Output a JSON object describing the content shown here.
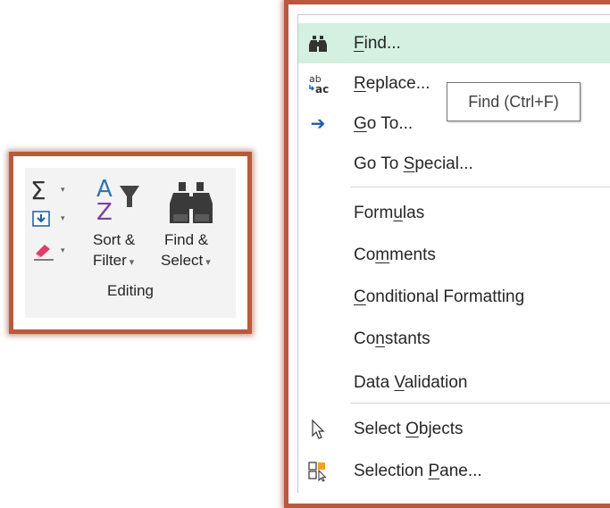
{
  "ribbon": {
    "group_label": "Editing",
    "sort_filter": {
      "line1": "Sort &",
      "line2": "Filter",
      "caret": "▾"
    },
    "find_select": {
      "line1": "Find &",
      "line2": "Select",
      "caret": "▾"
    },
    "sigma_glyph": "Σ",
    "caret": "▾",
    "sort_letters": {
      "a": "A",
      "z": "Z"
    }
  },
  "menu": {
    "items": [
      {
        "id": "find",
        "pre": "",
        "ul": "F",
        "post": "ind...",
        "icon": "binoculars-icon",
        "hover": true
      },
      {
        "id": "replace",
        "pre": "",
        "ul": "R",
        "post": "eplace...",
        "icon": "replace-icon",
        "icon_text_top": "ab",
        "icon_text_bottom": "ac"
      },
      {
        "id": "goto",
        "pre": "",
        "ul": "G",
        "post": "o To...",
        "icon": "arrow-right-icon",
        "icon_glyph": "➔"
      },
      {
        "id": "goto-special",
        "pre": "Go To ",
        "ul": "S",
        "post": "pecial...",
        "icon": ""
      },
      {
        "id": "formulas",
        "pre": "Form",
        "ul": "u",
        "post": "las",
        "icon": ""
      },
      {
        "id": "comments",
        "pre": "Co",
        "ul": "m",
        "post": "ments",
        "icon": ""
      },
      {
        "id": "conditional-formatting",
        "pre": "",
        "ul": "C",
        "post": "onditional Formatting",
        "icon": ""
      },
      {
        "id": "constants",
        "pre": "Co",
        "ul": "n",
        "post": "stants",
        "icon": ""
      },
      {
        "id": "data-validation",
        "pre": "Data ",
        "ul": "V",
        "post": "alidation",
        "icon": ""
      },
      {
        "id": "select-objects",
        "pre": "Select ",
        "ul": "O",
        "post": "bjects",
        "icon": "pointer-icon"
      },
      {
        "id": "selection-pane",
        "pre": "Selection ",
        "ul": "P",
        "post": "ane...",
        "icon": "selection-pane-icon"
      }
    ]
  },
  "tooltip": {
    "text": "Find (Ctrl+F)"
  },
  "colors": {
    "frame": "#b85a3c",
    "hover": "#d3f0e0",
    "arrow": "#1e5aa8",
    "sort_a": "#2e75b6",
    "sort_z": "#7f3f98",
    "eraser": "#e03c6e"
  }
}
